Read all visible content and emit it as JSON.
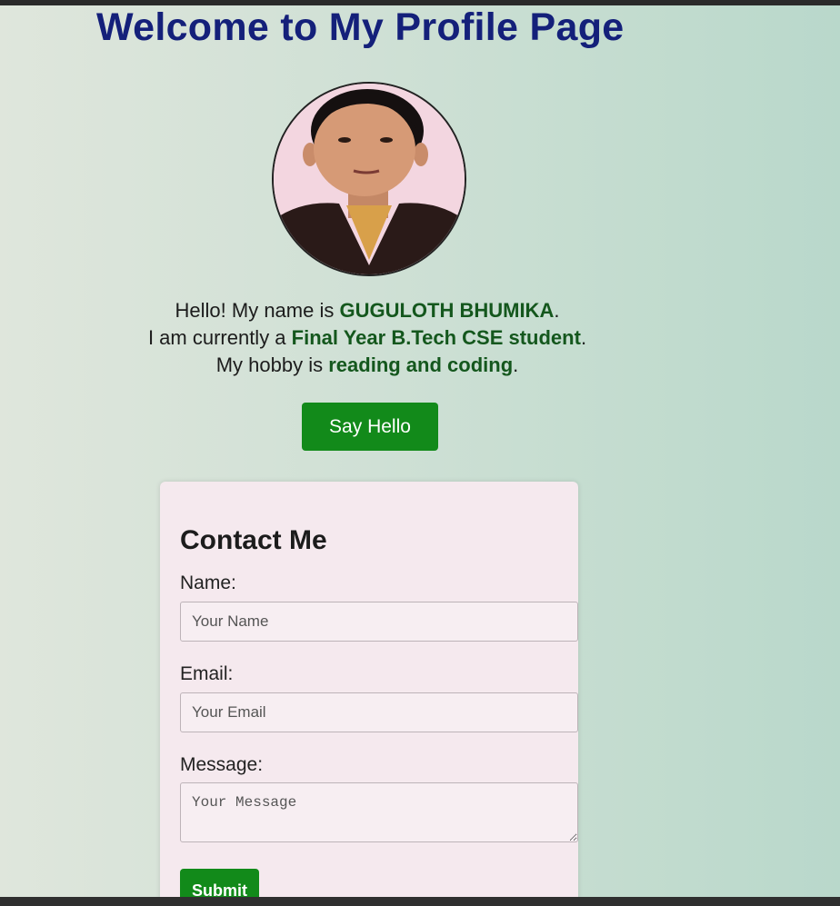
{
  "page": {
    "title": "Welcome to My Profile Page"
  },
  "profile": {
    "photo_icon": "profile-photo",
    "intro_prefix_1": "Hello! My name is ",
    "name": "GUGULOTH BHUMIKA",
    "intro_suffix_1": ".",
    "intro_prefix_2": "I am currently a ",
    "status": "Final Year B.Tech CSE student",
    "intro_suffix_2": ".",
    "intro_prefix_3": "My hobby is ",
    "hobby": "reading and coding",
    "intro_suffix_3": ".",
    "button_label": "Say Hello"
  },
  "contact": {
    "title": "Contact Me",
    "name_label": "Name:",
    "name_placeholder": "Your Name",
    "email_label": "Email:",
    "email_placeholder": "Your Email",
    "message_label": "Message:",
    "message_placeholder": "Your Message",
    "submit_label": "Submit"
  },
  "colors": {
    "title": "#14207a",
    "accent_green": "#128a1a",
    "highlight_text": "#14571d",
    "card_bg": "#f5e9ee"
  }
}
